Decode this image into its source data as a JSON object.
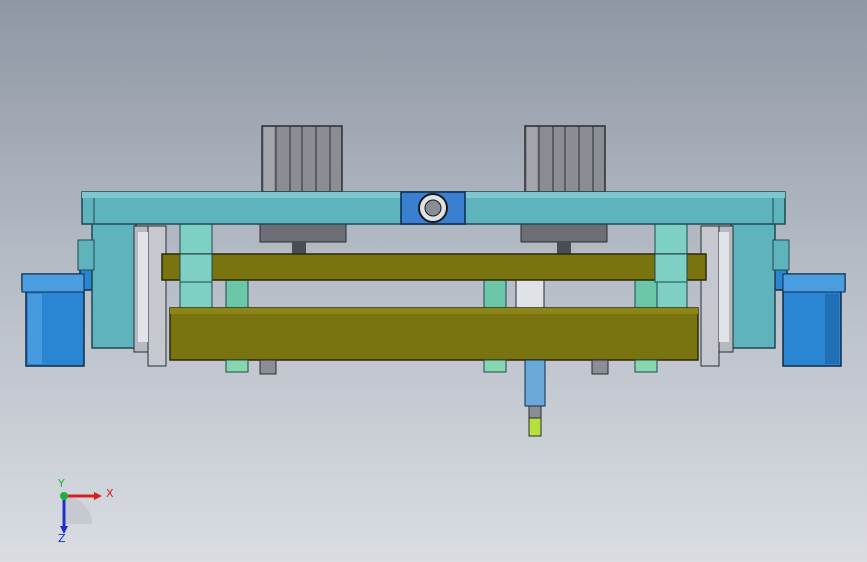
{
  "viewport": {
    "background_top": "#8e97a4",
    "background_bottom": "#d9dde2"
  },
  "model": {
    "colors": {
      "frame": "#5fb3bd",
      "frame_dark": "#3f8e98",
      "plate": "#7a7410",
      "plate_dark": "#56520a",
      "cylinder": "#2a86d3",
      "cylinder_dark": "#1a5fa0",
      "motor": "#8a8d93",
      "rail": "#b5b9c0",
      "pin_green": "#88d6b0",
      "tip_yellow": "#b8e03c",
      "hub": "#3a7fd0"
    }
  },
  "triad": {
    "x_label": "X",
    "y_label": "Y",
    "z_label": "Z",
    "x_color": "#d42020",
    "y_color": "#20b040",
    "z_color": "#2030c8"
  }
}
